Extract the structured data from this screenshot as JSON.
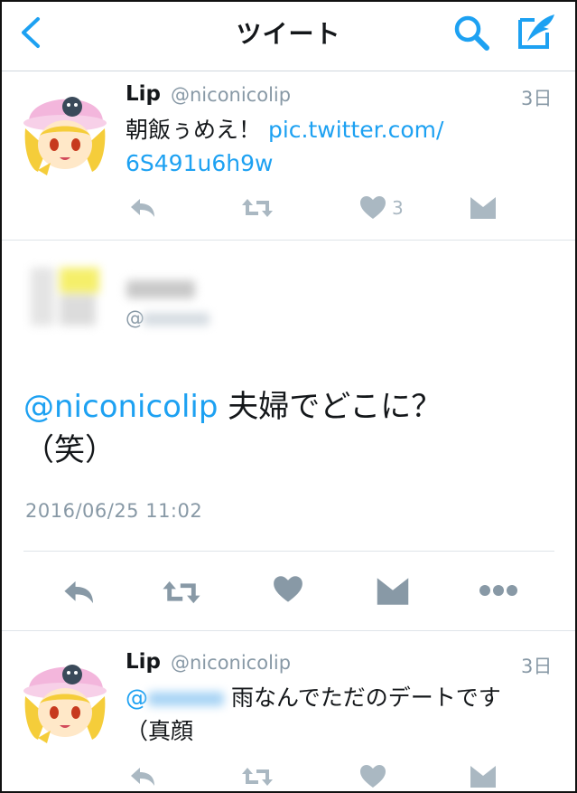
{
  "header": {
    "title": "ツイート"
  },
  "tweet1": {
    "name": "Lip",
    "handle": "@niconicolip",
    "time": "3日",
    "text_line1": "朝飯ぅめえ！",
    "link_part1": "pic.twitter.com/",
    "link_part2": "6S491u6h9w",
    "like_count": "3"
  },
  "detail": {
    "mention": "@niconicolip",
    "text_rest": " 夫婦でどこに？",
    "text_line2": "（笑）",
    "date": "2016/06/25 11:02",
    "handle_prefix": "@"
  },
  "tweet3": {
    "name": "Lip",
    "handle": "@niconicolip",
    "time": "3日",
    "mention_prefix": "@",
    "text_rest": " 雨なんでただのデートです",
    "text_line2": "（真顔"
  },
  "colors": {
    "accent": "#1da1f2",
    "icon_gray": "#aab8c2",
    "icon_dark": "#8899a6"
  }
}
